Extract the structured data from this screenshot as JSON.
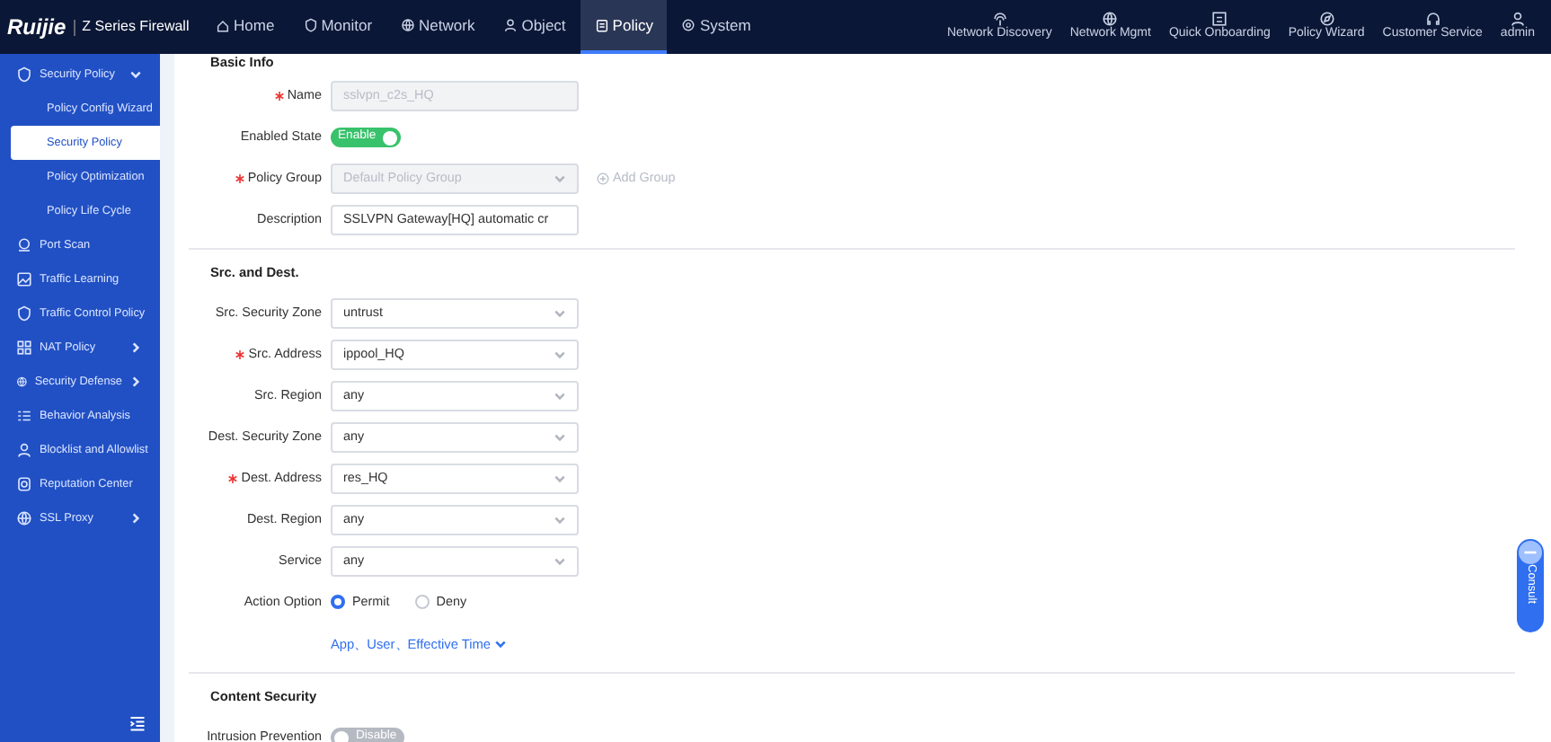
{
  "brand": {
    "logo": "Ruijie",
    "product": "Z Series Firewall"
  },
  "nav": [
    {
      "label": "Home",
      "selected": false
    },
    {
      "label": "Monitor",
      "selected": false
    },
    {
      "label": "Network",
      "selected": false
    },
    {
      "label": "Object",
      "selected": false
    },
    {
      "label": "Policy",
      "selected": true
    },
    {
      "label": "System",
      "selected": false
    }
  ],
  "tools": [
    {
      "label": "Network Discovery"
    },
    {
      "label": "Network Mgmt"
    },
    {
      "label": "Quick Onboarding"
    },
    {
      "label": "Policy Wizard"
    },
    {
      "label": "Customer Service"
    },
    {
      "label": "admin"
    }
  ],
  "sidebar": {
    "items": [
      {
        "label": "Security Policy",
        "kind": "group",
        "expanded": true,
        "children": [
          {
            "label": "Policy Config Wizard",
            "selected": false
          },
          {
            "label": "Security Policy",
            "selected": true
          },
          {
            "label": "Policy Optimization",
            "selected": false
          },
          {
            "label": "Policy Life Cycle",
            "selected": false
          }
        ]
      },
      {
        "label": "Port Scan",
        "kind": "item"
      },
      {
        "label": "Traffic Learning",
        "kind": "item"
      },
      {
        "label": "Traffic Control Policy",
        "kind": "item"
      },
      {
        "label": "NAT Policy",
        "kind": "group",
        "expanded": false
      },
      {
        "label": "Security Defense",
        "kind": "group",
        "expanded": false
      },
      {
        "label": "Behavior Analysis",
        "kind": "item"
      },
      {
        "label": "Blocklist and Allowlist",
        "kind": "item"
      },
      {
        "label": "Reputation Center",
        "kind": "item"
      },
      {
        "label": "SSL Proxy",
        "kind": "group",
        "expanded": false
      }
    ]
  },
  "form": {
    "sections": [
      {
        "title": "Basic Info",
        "fields": [
          {
            "kind": "input",
            "label": "Name",
            "required": true,
            "value": "sslvpn_c2s_HQ",
            "disabled": true
          },
          {
            "kind": "toggle",
            "label": "Enabled State",
            "required": false,
            "on": true,
            "text": "Enable"
          },
          {
            "kind": "select",
            "label": "Policy Group",
            "required": true,
            "value": "Default Policy Group",
            "disabled": true,
            "extra": "Add Group"
          },
          {
            "kind": "input",
            "label": "Description",
            "required": false,
            "value": "SSLVPN Gateway[HQ] automatic cr",
            "disabled": false
          }
        ]
      },
      {
        "title": "Src. and Dest.",
        "fields": [
          {
            "kind": "select",
            "label": "Src. Security Zone",
            "required": false,
            "value": "untrust",
            "disabled": false
          },
          {
            "kind": "select",
            "label": "Src. Address",
            "required": true,
            "value": "ippool_HQ",
            "disabled": false
          },
          {
            "kind": "select",
            "label": "Src. Region",
            "required": false,
            "value": "any",
            "disabled": false
          },
          {
            "kind": "select",
            "label": "Dest. Security Zone",
            "required": false,
            "value": "any",
            "disabled": false
          },
          {
            "kind": "select",
            "label": "Dest. Address",
            "required": true,
            "value": "res_HQ",
            "disabled": false
          },
          {
            "kind": "select",
            "label": "Dest. Region",
            "required": false,
            "value": "any",
            "disabled": false
          },
          {
            "kind": "select",
            "label": "Service",
            "required": false,
            "value": "any",
            "disabled": false
          },
          {
            "kind": "radio",
            "label": "Action Option",
            "required": false,
            "options": [
              {
                "label": "Permit",
                "selected": true
              },
              {
                "label": "Deny",
                "selected": false
              }
            ]
          },
          {
            "kind": "link",
            "text": "App、User、Effective Time"
          }
        ]
      },
      {
        "title": "Content Security",
        "fields": [
          {
            "kind": "toggle",
            "label": "Intrusion Prevention",
            "required": false,
            "on": false,
            "text": "Disable"
          }
        ]
      }
    ]
  },
  "consult": {
    "label": "Consult"
  }
}
